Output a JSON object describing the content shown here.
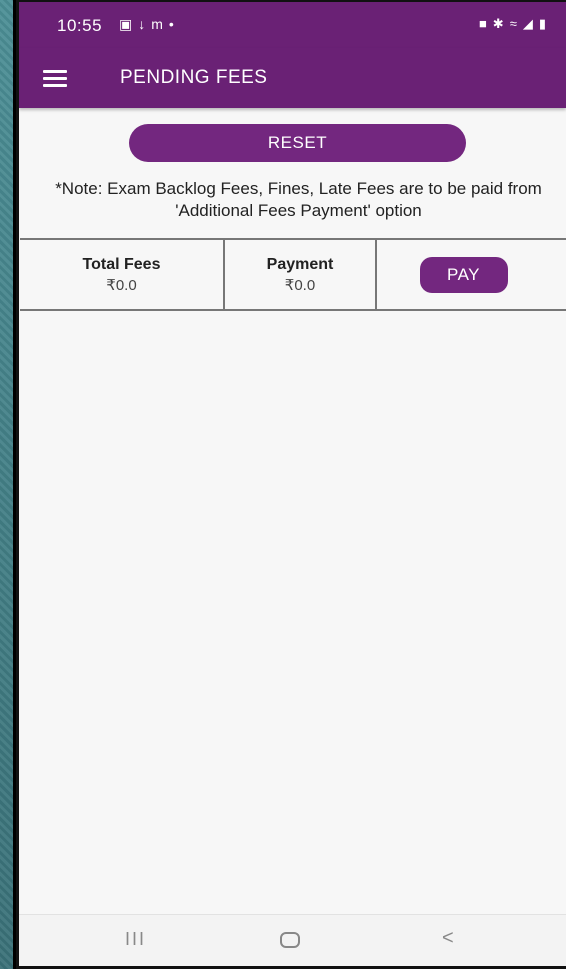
{
  "status_bar": {
    "time": "10:55",
    "left_icons": [
      "gallery-icon",
      "download-icon",
      "m-icon",
      "dot-icon"
    ],
    "right_icons": [
      "alarm-icon",
      "bluetooth-icon",
      "wifi-icon",
      "signal-icon",
      "battery-icon"
    ]
  },
  "app_bar": {
    "title": "PENDING FEES",
    "menu_icon": "menu-icon"
  },
  "actions": {
    "reset_label": "RESET"
  },
  "note": "*Note: Exam Backlog Fees, Fines, Late Fees are to be paid from 'Additional Fees Payment' option",
  "fees_summary": {
    "total_fees_label": "Total Fees",
    "total_fees_value": "₹0.0",
    "payment_label": "Payment",
    "payment_value": "₹0.0",
    "pay_label": "PAY"
  },
  "colors": {
    "primary": "#6a2175",
    "button": "#73277f"
  },
  "nav_bar": {
    "recent": "III",
    "back": "<"
  }
}
